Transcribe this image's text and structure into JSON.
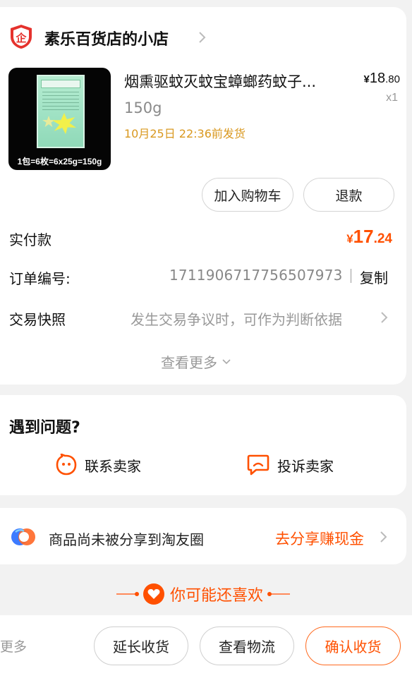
{
  "colors": {
    "accent": "#ff5000",
    "ship_note": "#d9981f",
    "background": "#f2f2f2"
  },
  "store": {
    "icon": "enterprise-shield-icon",
    "name": "素乐百货店的小店"
  },
  "product": {
    "image_caption": "1包=6枚=6x25g=150g",
    "title": "烟熏驱蚊灭蚊宝蟑螂药蚊子...",
    "price_symbol": "¥",
    "price_int": "18",
    "price_dec": ".80",
    "quantity": "x1",
    "spec": "150g",
    "ship_note": "10月25日 22:36前发货"
  },
  "actions": {
    "add_to_cart": "加入购物车",
    "refund": "退款"
  },
  "rows": {
    "paid_label": "实付款",
    "paid_symbol": "¥",
    "paid_int": "17",
    "paid_dec": ".24",
    "order_label": "订单编号:",
    "order_number": "1711906717756507973",
    "copy": "复制",
    "snapshot_label": "交易快照",
    "snapshot_desc": "发生交易争议时，可作为判断依据",
    "see_more": "查看更多"
  },
  "problem": {
    "title": "遇到问题?",
    "contact_seller": "联系卖家",
    "contact_icon": "chat-face-icon",
    "complain_seller": "投诉卖家",
    "complain_icon": "complaint-bubble-icon"
  },
  "share": {
    "icon": "taoyou-circle-icon",
    "text": "商品尚未被分享到淘友圈",
    "link": "去分享赚现金"
  },
  "recommend": {
    "title": "你可能还喜欢",
    "icon": "heart-icon"
  },
  "bottom": {
    "more": "更多",
    "extend": "延长收货",
    "logistics": "查看物流",
    "confirm": "确认收货"
  }
}
